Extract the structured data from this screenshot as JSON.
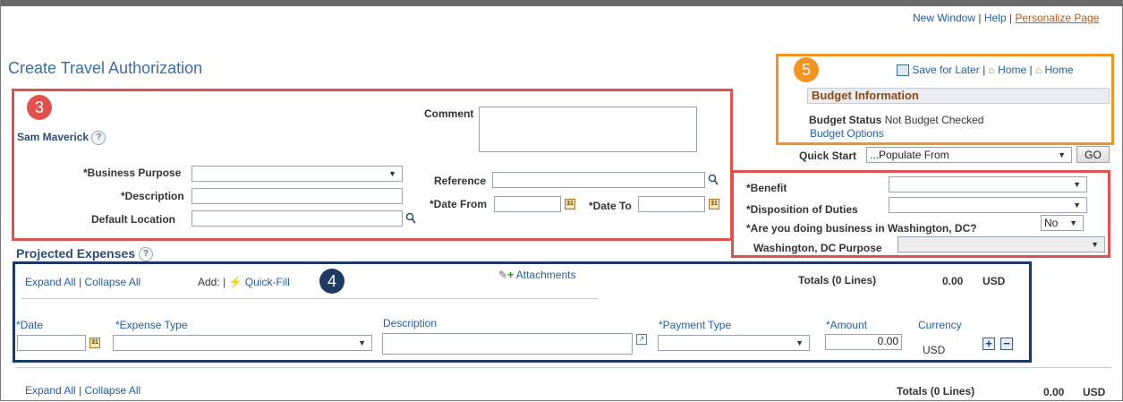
{
  "header": {
    "new_window": "New Window",
    "help": "Help",
    "personalize": "Personalize Page",
    "page_title": "Create Travel Authorization"
  },
  "toolbar": {
    "save_later": "Save for Later",
    "home1": "Home",
    "home2": "Home"
  },
  "budget": {
    "title": "Budget Information",
    "status_label": "Budget Status",
    "status_value": "Not Budget Checked",
    "options": "Budget Options"
  },
  "badges": {
    "b3": "3",
    "b4": "4",
    "b5": "5"
  },
  "traveler": {
    "name": "Sam Maverick",
    "help": "?"
  },
  "form": {
    "comment_label": "Comment",
    "business_purpose_label": "*Business Purpose",
    "description_label": "*Description",
    "default_location_label": "Default Location",
    "reference_label": "Reference",
    "date_from_label": "*Date From",
    "date_to_label": "*Date To"
  },
  "quick_start": {
    "label": "Quick Start",
    "value": "...Populate From",
    "go": "GO"
  },
  "benefit_section": {
    "benefit_label": "*Benefit",
    "disposition_label": "*Disposition of Duties",
    "dc_question": "*Are you doing business in Washington, DC?",
    "dc_value": "No",
    "dc_purpose_label": "Washington, DC Purpose"
  },
  "expenses": {
    "title": "Projected Expenses",
    "help": "?",
    "expand_all": "Expand All",
    "collapse_all": "Collapse All",
    "add_label": "Add:",
    "quick_fill": "Quick-Fill",
    "attachments": "Attachments",
    "totals_label": "Totals (0 Lines)",
    "totals_value": "0.00",
    "totals_currency": "USD",
    "columns": {
      "date": "*Date",
      "expense_type": "*Expense Type",
      "description": "Description",
      "payment_type": "*Payment Type",
      "amount": "*Amount",
      "currency": "Currency"
    },
    "row": {
      "amount": "0.00",
      "currency": "USD"
    },
    "add_row": "+",
    "remove_row": "−"
  },
  "footer": {
    "expand_all": "Expand All",
    "collapse_all": "Collapse All",
    "totals_label": "Totals (0 Lines)",
    "totals_value": "0.00",
    "totals_currency": "USD"
  },
  "colors": {
    "red": "#e0504d",
    "navy": "#1e3a63",
    "orange": "#f39422",
    "link": "#1f5fa8"
  }
}
